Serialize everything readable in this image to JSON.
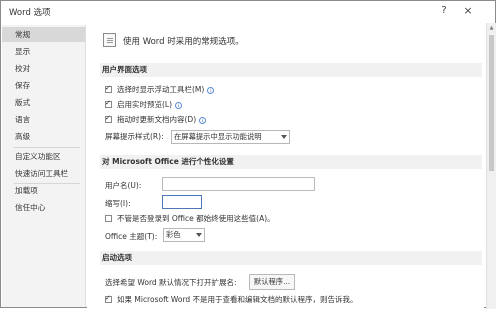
{
  "window": {
    "title": "Word 选项",
    "help": "?",
    "close": "×"
  },
  "sidebar": {
    "items": [
      {
        "label": "常规"
      },
      {
        "label": "显示"
      },
      {
        "label": "校对"
      },
      {
        "label": "保存"
      },
      {
        "label": "版式"
      },
      {
        "label": "语言"
      },
      {
        "label": "高级"
      },
      {
        "label": "自定义功能区"
      },
      {
        "label": "快速访问工具栏"
      },
      {
        "label": "加载项"
      },
      {
        "label": "信任中心"
      }
    ]
  },
  "main": {
    "intro": "使用 Word 时采用的常规选项。",
    "ui_section": {
      "title": "用户界面选项",
      "options": [
        {
          "label": "选择时显示浮动工具栏(M)",
          "checked": true
        },
        {
          "label": "启用实时预览(L)",
          "checked": true
        },
        {
          "label": "拖动时更新文档内容(D)",
          "checked": true
        }
      ],
      "screentip_label": "屏幕提示样式(R):",
      "screentip_value": "在屏幕提示中显示功能说明"
    },
    "personalize_section": {
      "title": "对 Microsoft Office 进行个性化设置",
      "username_label": "用户名(U):",
      "username_value": "",
      "initials_label": "缩写(I):",
      "initials_value": "",
      "always_use_label": "不管是否登录到 Office 都始终使用这些值(A)。",
      "always_use_checked": false,
      "theme_label": "Office 主题(T):",
      "theme_value": "彩色"
    },
    "startup_section": {
      "title": "启动选项",
      "ext_label": "选择希望 Word 默认情况下打开扩展名:",
      "default_programs_button": "默认程序...",
      "notify_label": "如果 Microsoft Word 不是用于查看和编辑文档的默认程序，则告诉我。",
      "notify_checked": true
    }
  }
}
